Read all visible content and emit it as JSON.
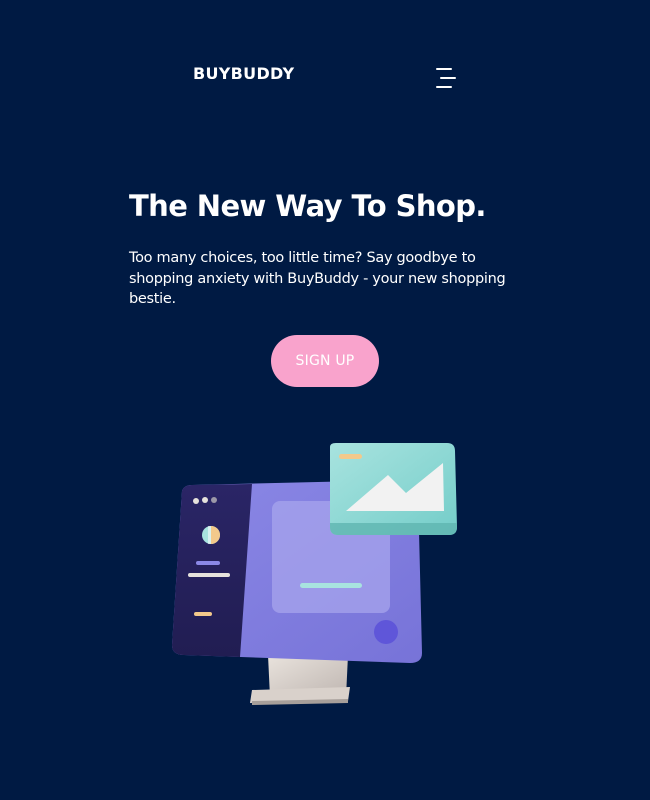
{
  "header": {
    "brand": "BUYBUDDY",
    "menu_icon": "hamburger-menu-icon"
  },
  "hero": {
    "title": "The New Way To Shop.",
    "description": "Too many choices, too little time? Say goodbye to shopping anxiety with BuyBuddy - your new shopping bestie.",
    "cta_label": "SIGN UP"
  },
  "illustration": {
    "icon": "computer-monitor-illustration"
  },
  "colors": {
    "background": "#001a43",
    "cta": "#f9a3cc",
    "text": "#ffffff"
  }
}
